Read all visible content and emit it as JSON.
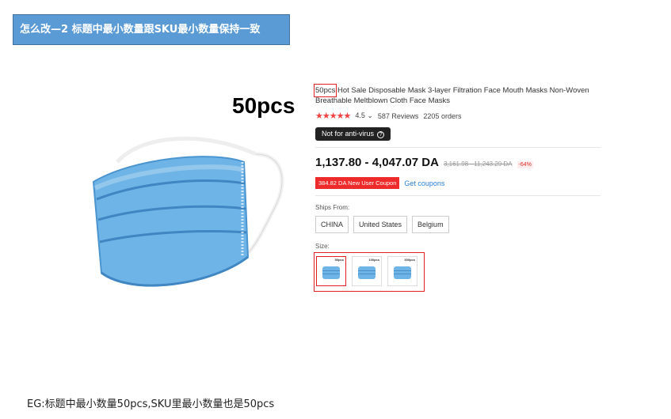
{
  "banner": {
    "text": "怎么改—2 标题中最小数量跟SKU最小数量保持一致"
  },
  "image_caption": "50pcs",
  "product": {
    "title_qty": "50pcs",
    "title_rest": " Hot Sale Disposable Mask 3-layer Filtration Face Mouth Masks Non-Woven Breathable Meltblown Cloth Face Masks",
    "stars": "★★★★★",
    "rating": "4.5",
    "rating_chevron": "⌄",
    "reviews": "587 Reviews",
    "orders": "2205 orders",
    "notice": "Not for anti-virus",
    "notice_icon": "?",
    "price": "1,137.80 - 4,047.07 DA",
    "old_price": "3,161.98 - 11,243.29 DA",
    "discount": "-64%",
    "coupon": "384.82 DA New User Coupon",
    "get_coupons": "Get coupons",
    "ships_from_label": "Ships From:",
    "ships_from": [
      "CHINA",
      "United States",
      "Belgium"
    ],
    "size_label": "Size:",
    "size_options": [
      "50pcs",
      "100pcs",
      "300pcs"
    ]
  },
  "footer": {
    "text": "EG:标题中最小数量50pcs,SKU里最小数量也是50pcs"
  },
  "colors": {
    "banner_bg": "#5b9bd5",
    "highlight_red": "#e02020",
    "mask_blue": "#6fb4e6",
    "coupon_red": "#ee2a2a",
    "link_blue": "#2a7fd4"
  },
  "icons": {
    "question": "question-circle-icon",
    "mask": "face-mask-icon"
  }
}
